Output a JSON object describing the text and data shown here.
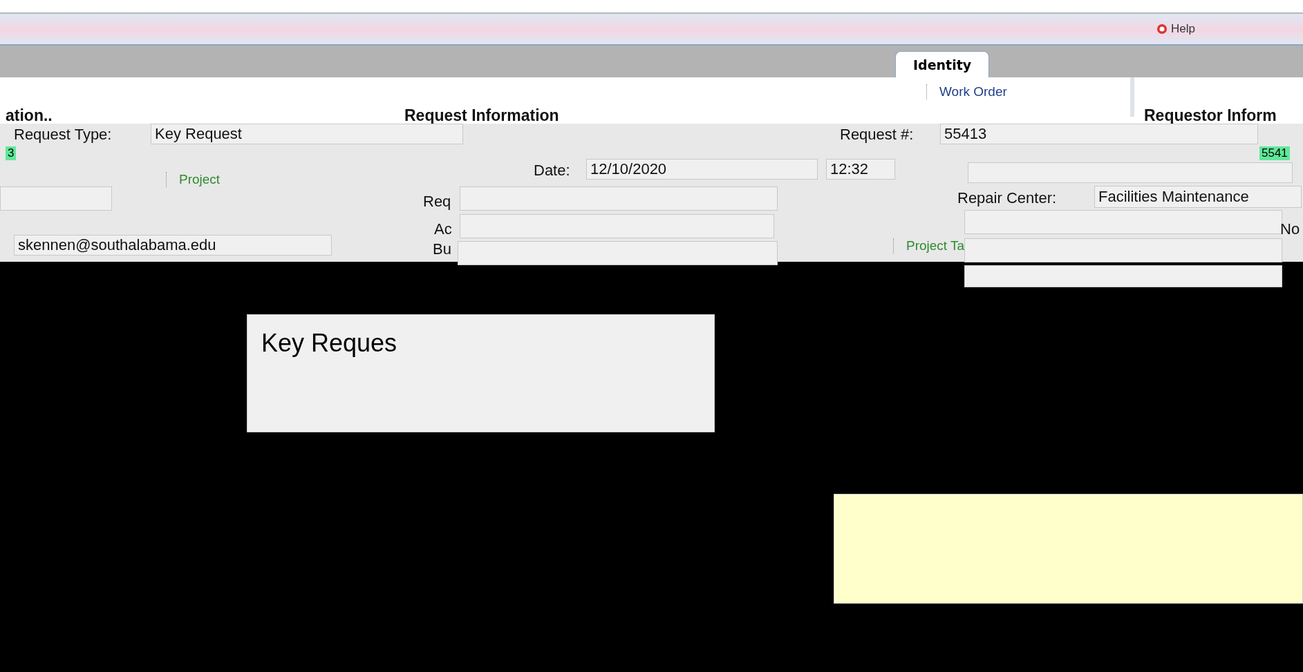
{
  "toolbar": {
    "buttons": [
      {
        "label": "Help"
      }
    ]
  },
  "tabs": [
    {
      "label": "Identity",
      "selected": true
    }
  ],
  "tree_items": [
    {
      "label": "Work Order",
      "kind": "node"
    },
    {
      "label": "Project",
      "kind": "link"
    },
    {
      "label": "Project Ta",
      "kind": "link"
    }
  ],
  "section_headings": [
    "ation..",
    "Request Information",
    "Requestor Inform"
  ],
  "badges": [
    "3",
    "5541"
  ],
  "fields": [
    {
      "label": "Request Type:",
      "value": "Key Request"
    },
    {
      "label": "Request #:",
      "value": "55413"
    },
    {
      "label": "Date:",
      "value": "12/10/2020"
    },
    {
      "value": "12:32"
    },
    {
      "label": "Req"
    },
    {
      "label": "Repair Center:",
      "value": "Facilities Maintenance"
    },
    {
      "label": "Ac"
    },
    {
      "label": "No"
    },
    {
      "value": "skennen@southalabama.edu"
    },
    {
      "label": "Bu"
    }
  ],
  "description": {
    "value": "Key Reques"
  },
  "note_panel": {
    "kind": "empty"
  }
}
